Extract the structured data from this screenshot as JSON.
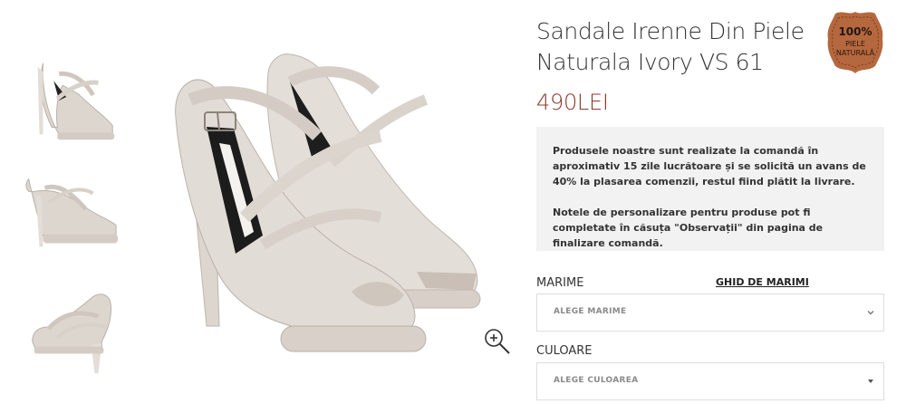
{
  "product": {
    "title": "Sandale Irenne Din Piele Naturala Ivory VS 61",
    "price": "490LEI"
  },
  "badge": {
    "percent": "100%",
    "line1": "PIELE",
    "line2": "NATURALĂ",
    "color": "#b5673e"
  },
  "info": {
    "paragraph1": "Produsele noastre sunt realizate la comandă în aproximativ 15 zile lucrătoare și se solicită un avans de 40% la plasarea comenzii, restul fiind plătit la livrare.",
    "paragraph2": "Notele de personalizare pentru produse pot fi completate în căsuța \"Observații\" din pagina de finalizare comandă."
  },
  "size": {
    "label": "MARIME",
    "guide_link": "GHID DE MARIMI",
    "select_placeholder": "ALEGE MARIME"
  },
  "color": {
    "label": "CULOARE",
    "select_placeholder": "ALEGE CULOAREA"
  },
  "icons": {
    "zoom": "zoom-in-icon",
    "chevron": "chevron-down-icon"
  },
  "colors": {
    "price": "#8b3a2c",
    "info_bg": "#f2f2f2",
    "shoe": "#ddd6cf"
  }
}
